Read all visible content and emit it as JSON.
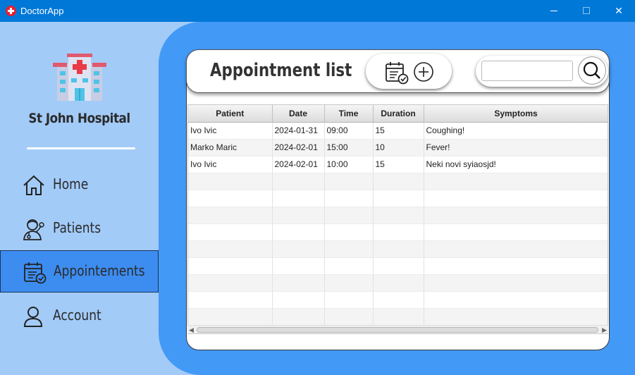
{
  "window": {
    "title": "DoctorApp",
    "minimize": "—",
    "maximize": "□",
    "close": "✕"
  },
  "sidebar": {
    "hospital_name": "St John Hospital",
    "items": [
      {
        "label": "Home",
        "icon": "home-icon"
      },
      {
        "label": "Patients",
        "icon": "doctor-icon"
      },
      {
        "label": "Appointements",
        "icon": "calendar-check-icon"
      },
      {
        "label": "Account",
        "icon": "user-icon"
      }
    ]
  },
  "header": {
    "title": "Appointment list",
    "search": {
      "value": "",
      "placeholder": ""
    }
  },
  "table": {
    "columns": [
      "Patient",
      "Date",
      "Time",
      "Duration",
      "Symptoms"
    ],
    "rows": [
      [
        "Ivo Ivic",
        "2024-01-31",
        "09:00",
        "15",
        "Coughing!"
      ],
      [
        "Marko Maric",
        "2024-02-01",
        "15:00",
        "10",
        "Fever!"
      ],
      [
        "Ivo Ivic",
        "2024-02-01",
        "10:00",
        "15",
        "Neki novi syiaosjd!"
      ]
    ]
  },
  "colors": {
    "titlebar": "#0078d7",
    "sidebar": "#a3cbf8",
    "main": "#4299f6",
    "active_nav": "#3d8df0"
  }
}
